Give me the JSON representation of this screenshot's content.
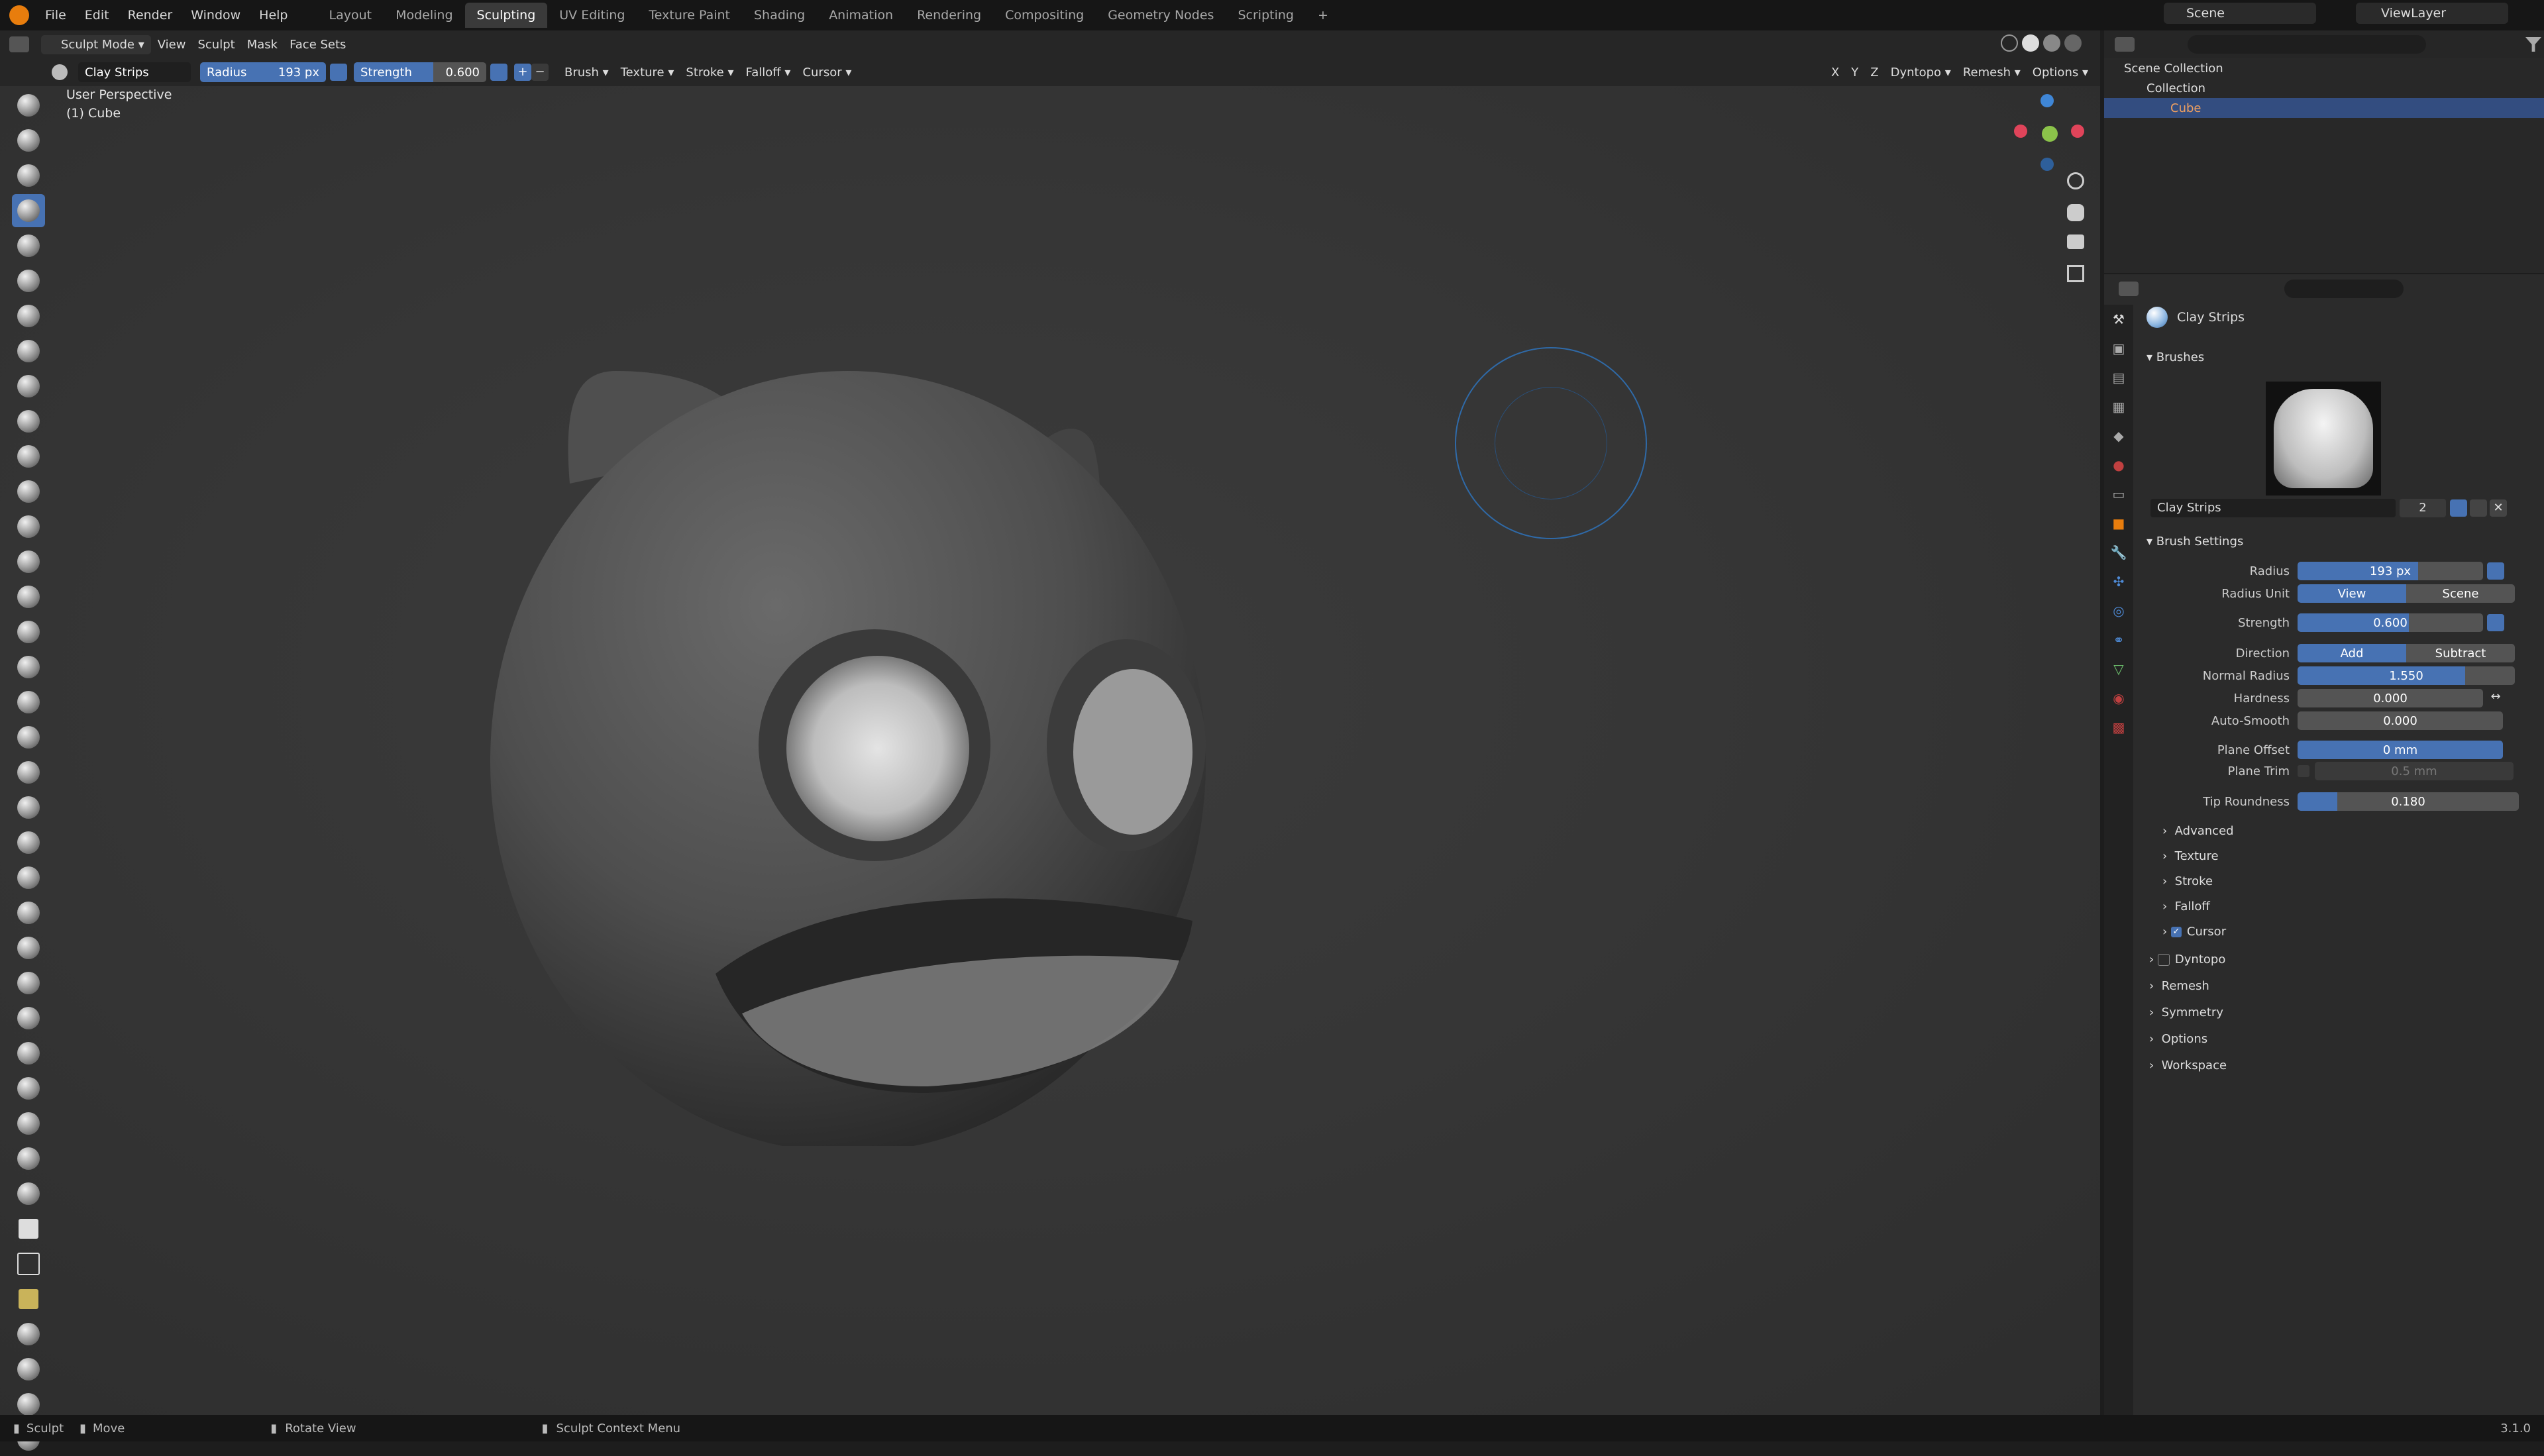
{
  "topbar": {
    "menus": [
      "File",
      "Edit",
      "Render",
      "Window",
      "Help"
    ],
    "workspaces": [
      "Layout",
      "Modeling",
      "Sculpting",
      "UV Editing",
      "Texture Paint",
      "Shading",
      "Animation",
      "Rendering",
      "Compositing",
      "Geometry Nodes",
      "Scripting"
    ],
    "active_workspace": "Sculpting",
    "add_label": "+",
    "scene": "Scene",
    "view_layer": "ViewLayer"
  },
  "header": {
    "mode": "Sculpt Mode",
    "menus": [
      "View",
      "Sculpt",
      "Mask",
      "Face Sets"
    ],
    "brush_name": "Clay Strips",
    "radius_label": "Radius",
    "radius_value": "193 px",
    "strength_label": "Strength",
    "strength_value": "0.600",
    "dropdowns": [
      "Brush",
      "Texture",
      "Stroke",
      "Falloff",
      "Cursor"
    ],
    "axes": [
      "X",
      "Y",
      "Z"
    ],
    "right": [
      "Dyntopo",
      "Remesh",
      "Options"
    ]
  },
  "viewport": {
    "line1": "User Perspective",
    "line2": "(1) Cube"
  },
  "outliner": {
    "scene_collection": "Scene Collection",
    "collection": "Collection",
    "object": "Cube"
  },
  "properties": {
    "brush_title": "Clay Strips",
    "brushes_panel": "Brushes",
    "brush_slot_name": "Clay Strips",
    "brush_users": "2",
    "settings_panel": "Brush Settings",
    "rows": {
      "radius": {
        "label": "Radius",
        "value": "193 px",
        "fill": 0.65
      },
      "radius_unit": {
        "label": "Radius Unit",
        "a": "View",
        "b": "Scene"
      },
      "strength": {
        "label": "Strength",
        "value": "0.600",
        "fill": 0.6
      },
      "direction": {
        "label": "Direction",
        "a": "Add",
        "b": "Subtract"
      },
      "normal_radius": {
        "label": "Normal Radius",
        "value": "1.550",
        "fill": 0.77
      },
      "hardness": {
        "label": "Hardness",
        "value": "0.000"
      },
      "auto_smooth": {
        "label": "Auto-Smooth",
        "value": "0.000"
      },
      "plane_offset": {
        "label": "Plane Offset",
        "value": "0 mm",
        "fill": 1.0
      },
      "plane_trim": {
        "label": "Plane Trim",
        "value": "0.5 mm"
      },
      "tip_roundness": {
        "label": "Tip Roundness",
        "value": "0.180",
        "fill": 0.18
      }
    },
    "subpanels": [
      "Advanced",
      "Texture",
      "Stroke",
      "Falloff",
      "Cursor"
    ],
    "panels": [
      "Dyntopo",
      "Remesh",
      "Symmetry",
      "Options",
      "Workspace"
    ]
  },
  "statusbar": {
    "sculpt": "Sculpt",
    "move": "Move",
    "rotate": "Rotate View",
    "context": "Sculpt Context Menu",
    "version": "3.1.0"
  },
  "colors": {
    "accent": "#4772b3",
    "x_axis": "#e0445a",
    "y_axis": "#8bc34a",
    "z_axis": "#3f86d6"
  }
}
